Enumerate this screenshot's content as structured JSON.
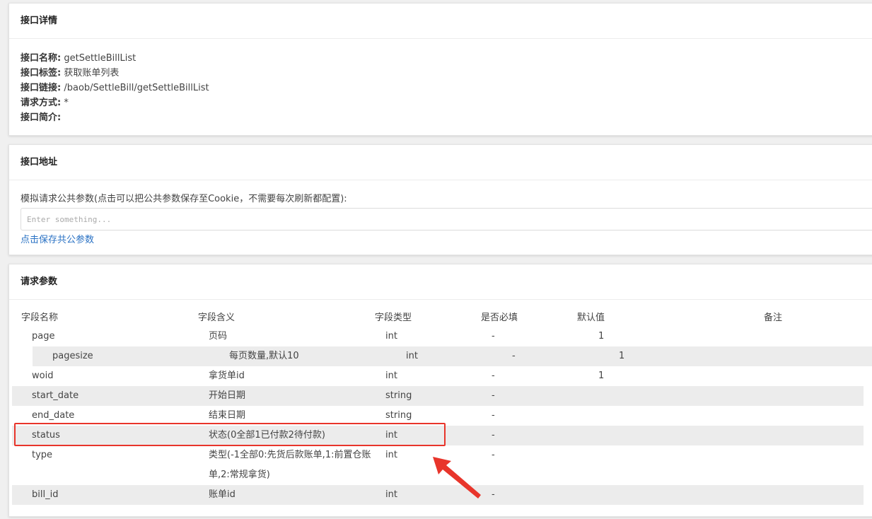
{
  "detail": {
    "title": "接口详情",
    "rows": [
      {
        "label": "接口名称:",
        "value": "getSettleBillList"
      },
      {
        "label": "接口标签:",
        "value": "获取账单列表"
      },
      {
        "label": "接口链接:",
        "value": "/baob/SettleBill/getSettleBillList"
      },
      {
        "label": "请求方式:",
        "value": "*"
      },
      {
        "label": "接口简介:",
        "value": ""
      }
    ]
  },
  "address": {
    "title": "接口地址",
    "description": "模拟请求公共参数(点击可以把公共参数保存至Cookie，不需要每次刷新都配置):",
    "input_placeholder": "Enter something...",
    "input_value": "",
    "save_link": "点击保存共公参数"
  },
  "params": {
    "title": "请求参数",
    "headers": [
      "字段名称",
      "字段含义",
      "字段类型",
      "是否必填",
      "默认值",
      "备注"
    ],
    "rows": [
      {
        "name": "page",
        "meaning": "页码",
        "type": "int",
        "required": "-",
        "default": "1",
        "note": ""
      },
      {
        "name": "pagesize",
        "meaning": "每页数量,默认10",
        "type": "int",
        "required": "-",
        "default": "1",
        "note": ""
      },
      {
        "name": "woid",
        "meaning": "拿货单id",
        "type": "int",
        "required": "-",
        "default": "1",
        "note": ""
      },
      {
        "name": "start_date",
        "meaning": "开始日期",
        "type": "string",
        "required": "-",
        "default": "",
        "note": ""
      },
      {
        "name": "end_date",
        "meaning": "结束日期",
        "type": "string",
        "required": "-",
        "default": "",
        "note": ""
      },
      {
        "name": "status",
        "meaning": "状态(0全部1已付款2待付款)",
        "type": "int",
        "required": "-",
        "default": "",
        "note": ""
      },
      {
        "name": "type",
        "meaning": "类型(-1全部0:先货后款账单,1:前置仓账单,2:常规拿货)",
        "type": "int",
        "required": "-",
        "default": "",
        "note": ""
      },
      {
        "name": "bill_id",
        "meaning": "账单id",
        "type": "int",
        "required": "-",
        "default": "",
        "note": ""
      }
    ]
  },
  "annotation": {
    "highlight_color": "#e8352b"
  }
}
